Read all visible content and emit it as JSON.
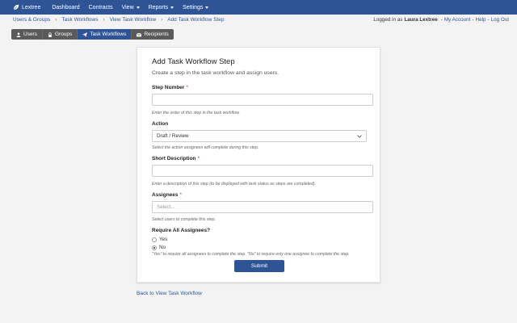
{
  "topnav": {
    "brand": "Lextree",
    "items": [
      {
        "label": "Dashboard",
        "caret": false
      },
      {
        "label": "Contracts",
        "caret": false
      },
      {
        "label": "View",
        "caret": true
      },
      {
        "label": "Reports",
        "caret": true
      },
      {
        "label": "Settings",
        "caret": true
      }
    ]
  },
  "breadcrumb": [
    "Users & Groups",
    "Task Workflows",
    "View Task Workflow",
    "Add Task Workflow Step"
  ],
  "account": {
    "prefix": "Logged in as",
    "user": "Laura Lextree",
    "links": [
      "My Account",
      "Help",
      "Log Out"
    ]
  },
  "tabs": [
    {
      "label": "Users",
      "icon": "user-icon",
      "active": false
    },
    {
      "label": "Groups",
      "icon": "lock-icon",
      "active": false
    },
    {
      "label": "Task Workflows",
      "icon": "paper-plane-icon",
      "active": true
    },
    {
      "label": "Recipients",
      "icon": "envelope-icon",
      "active": false
    }
  ],
  "form": {
    "title": "Add Task Workflow Step",
    "subtitle": "Create a step in the task workflow and assign users.",
    "step_number": {
      "label": "Step Number",
      "value": "",
      "help": "Enter the order of this step in the task workflow."
    },
    "action": {
      "label": "Action",
      "value": "Draft / Review",
      "help": "Select the action assignees will complete during this step."
    },
    "short_description": {
      "label": "Short Description",
      "value": "",
      "help": "Enter a description of this step (to be displayed with task status as steps are completed)."
    },
    "assignees": {
      "label": "Assignees",
      "placeholder": "Select...",
      "help": "Select users to complete this step."
    },
    "require_all": {
      "label": "Require All Assignees?",
      "options": [
        {
          "label": "Yes",
          "checked": false
        },
        {
          "label": "No",
          "checked": true
        }
      ],
      "help": "\"Yes\" to require all assignees to complete the step. \"No\" to require only one assignee to complete the step."
    },
    "submit_label": "Submit",
    "required_marker": "*"
  },
  "back_link": "Back to View Task Workflow",
  "colors": {
    "primary": "#2f5496",
    "tab_bg": "#5a5a5a",
    "page_bg": "#f3f3f3",
    "required": "#c0392b"
  }
}
